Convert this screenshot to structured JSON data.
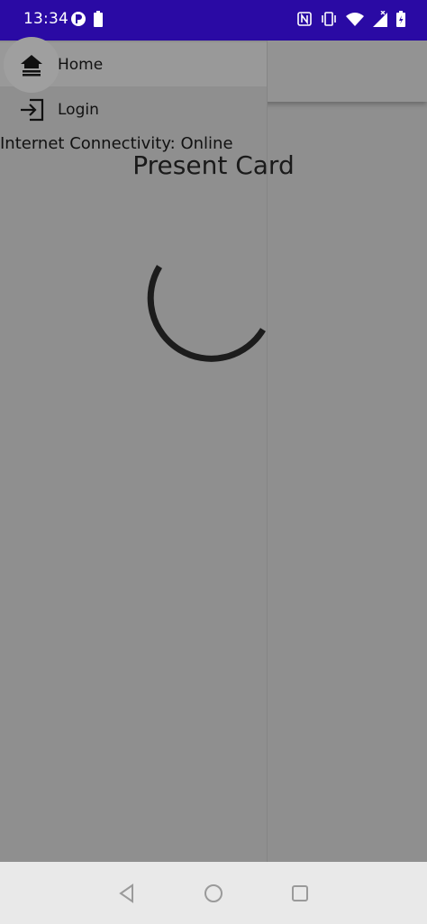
{
  "status_bar": {
    "time": "13:34",
    "icons_left": [
      "app-notification-icon",
      "battery-saver-icon"
    ],
    "icons_right": [
      "nfc-icon",
      "vibrate-icon",
      "wifi-icon",
      "cellular-signal-icon",
      "battery-icon"
    ],
    "background": "#2a0aa4"
  },
  "drawer": {
    "items": [
      {
        "label": "Home",
        "icon": "home-icon",
        "selected": true
      },
      {
        "label": "Login",
        "icon": "login-icon",
        "selected": false
      }
    ]
  },
  "main": {
    "connectivity_text": "Internet Connectivity: Online",
    "title": "Present Card",
    "loading_indicator": "progress-spinner"
  },
  "nav_bar": {
    "buttons": [
      "back-button",
      "home-button",
      "recents-button"
    ]
  },
  "colors": {
    "scrim": "#8f8f8f",
    "text": "#111111",
    "nav_bar": "#e9e9e9"
  }
}
